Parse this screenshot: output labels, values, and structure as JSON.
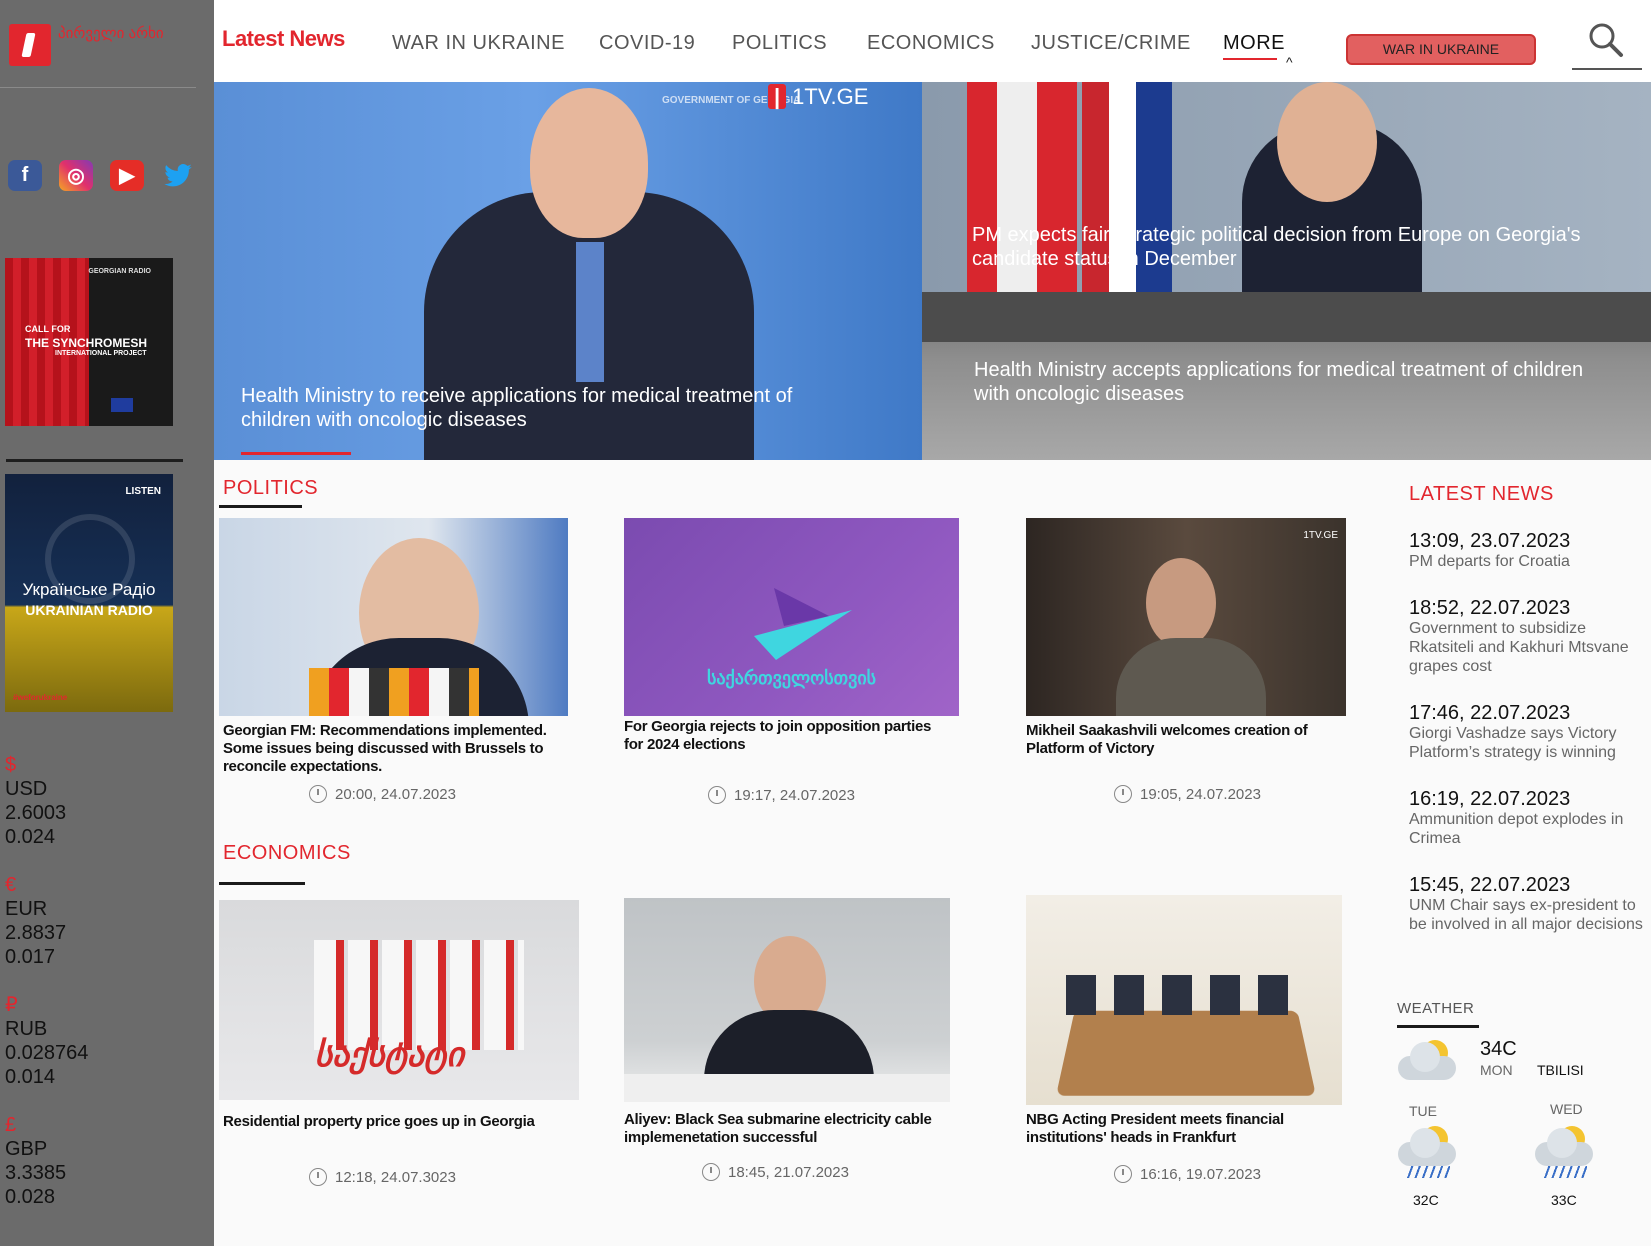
{
  "sidebar": {
    "logo_text": "პირველი არხი",
    "socials": [
      {
        "name": "facebook",
        "glyph": "f"
      },
      {
        "name": "instagram",
        "glyph": "◎"
      },
      {
        "name": "youtube",
        "glyph": "▶"
      },
      {
        "name": "twitter",
        "glyph": "🐦"
      }
    ],
    "banner1": {
      "radio": "GEORGIAN RADIO",
      "call": "CALL FOR",
      "project": "THE SYNCHROMESH",
      "sub": "INTERNATIONAL PROJECT"
    },
    "banner2": {
      "listen": "LISTEN",
      "ua": "Українське Радіо",
      "en": "UKRAINIAN RADIO",
      "tag": "#weforukraine"
    },
    "rates": [
      {
        "symbol": "$",
        "currency": "USD",
        "value": "2.6003",
        "change": "0.024"
      },
      {
        "symbol": "€",
        "currency": "EUR",
        "value": "2.8837",
        "change": "0.017"
      },
      {
        "symbol": "₽",
        "currency": "RUB",
        "value": "0.028764",
        "change": "0.014"
      },
      {
        "symbol": "£",
        "currency": "GBP",
        "value": "3.3385",
        "change": "0.028"
      }
    ]
  },
  "header": {
    "brand": "Latest News",
    "nav": [
      "WAR IN UKRAINE",
      "COVID-19",
      "POLITICS",
      "ECONOMICS",
      "JUSTICE/CRIME",
      "MORE"
    ],
    "caret": "^",
    "war_button": "WAR IN UKRAINE"
  },
  "hero": {
    "main_caption": "Health Ministry to receive applications for medical treatment of children with oncologic diseases",
    "main_logo": "1TV.GE",
    "gov_text": "GOVERNMENT OF GEORGIA",
    "right_top_caption": "PM expects fair, strategic political decision from Europe on Georgia's candidate status in December",
    "right_bottom_caption": "Health Ministry accepts applications for medical treatment of children with oncologic diseases"
  },
  "politics": {
    "title": "POLITICS",
    "cards": [
      {
        "title": "Georgian FM: Recommendations implemented. Some issues being discussed with Brussels to reconcile expectations.",
        "time": "20:00, 24.07.2023"
      },
      {
        "title": "For Georgia rejects to join opposition parties for 2024 elections",
        "time": "19:17, 24.07.2023",
        "img_text": "საქართველოსთვის"
      },
      {
        "title": "Mikheil Saakashvili welcomes creation of Platform of Victory",
        "time": "19:05, 24.07.2023",
        "img_text": "1TV.GE"
      }
    ]
  },
  "economics": {
    "title": "ECONOMICS",
    "cards": [
      {
        "title": "Residential property price goes up in Georgia",
        "time": "12:18, 24.07.3023",
        "img_text": "საქსტატი"
      },
      {
        "title": "Aliyev: Black Sea submarine electricity cable implemenetation successful",
        "time": "18:45, 21.07.2023"
      },
      {
        "title": "NBG Acting President meets financial institutions' heads in Frankfurt",
        "time": "16:16, 19.07.2023"
      }
    ]
  },
  "latest": {
    "title": "LATEST NEWS",
    "items": [
      {
        "time": "13:09, 23.07.2023",
        "headline": "PM departs for Croatia"
      },
      {
        "time": "18:52, 22.07.2023",
        "headline": "Government to subsidize Rkatsiteli and Kakhuri Mtsvane grapes cost"
      },
      {
        "time": "17:46, 22.07.2023",
        "headline": "Giorgi Vashadze says Victory Platform’s strategy is winning"
      },
      {
        "time": "16:19, 22.07.2023",
        "headline": "Ammunition depot explodes in Crimea"
      },
      {
        "time": "15:45, 22.07.2023",
        "headline": "UNM Chair says ex-president to be involved in all major decisions"
      }
    ]
  },
  "weather": {
    "title": "WEATHER",
    "today": {
      "temp": "34C",
      "day": "MON",
      "city": "TBILISI",
      "icon": "partly-cloudy-icon"
    },
    "forecast": [
      {
        "day": "TUE",
        "temp": "32C",
        "icon": "rain-icon"
      },
      {
        "day": "WED",
        "temp": "33C",
        "icon": "rain-icon"
      }
    ]
  }
}
